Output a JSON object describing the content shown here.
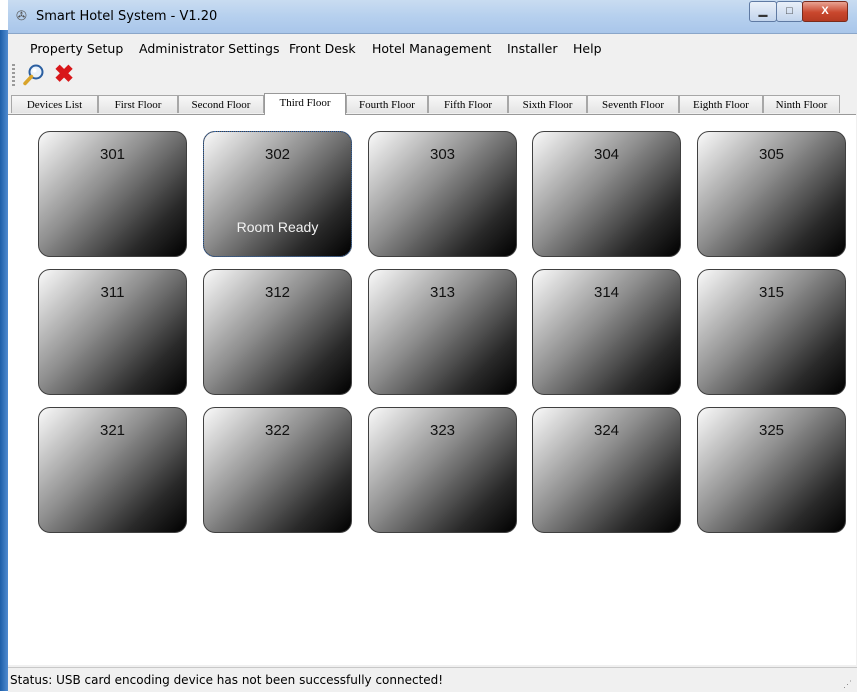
{
  "window": {
    "title": "Smart Hotel System - V1.20"
  },
  "menu": [
    "Property Setup",
    "Administrator Settings",
    "Front Desk",
    "Hotel Management",
    "Installer",
    "Help"
  ],
  "toolbar": {
    "search_icon": "magnifier-icon",
    "close_icon": "red-x-icon",
    "close_glyph": "✖"
  },
  "tabs": [
    "Devices List",
    "First Floor",
    "Second Floor",
    "Third Floor",
    "Fourth Floor",
    "Fifth Floor",
    "Sixth Floor",
    "Seventh Floor",
    "Eighth Floor",
    "Ninth Floor"
  ],
  "active_tab": "Third Floor",
  "rooms": [
    {
      "number": "301",
      "status": ""
    },
    {
      "number": "302",
      "status": "Room Ready"
    },
    {
      "number": "303",
      "status": ""
    },
    {
      "number": "304",
      "status": ""
    },
    {
      "number": "305",
      "status": ""
    },
    {
      "number": "311",
      "status": ""
    },
    {
      "number": "312",
      "status": ""
    },
    {
      "number": "313",
      "status": ""
    },
    {
      "number": "314",
      "status": ""
    },
    {
      "number": "315",
      "status": ""
    },
    {
      "number": "321",
      "status": ""
    },
    {
      "number": "322",
      "status": ""
    },
    {
      "number": "323",
      "status": ""
    },
    {
      "number": "324",
      "status": ""
    },
    {
      "number": "325",
      "status": ""
    }
  ],
  "status_bar": {
    "text": "Status: USB card encoding device has not been successfully connected!"
  },
  "colors": {
    "title_bar": "#b6d0ee",
    "close_button": "#c9472d",
    "toolbar_close": "#d8171a"
  }
}
